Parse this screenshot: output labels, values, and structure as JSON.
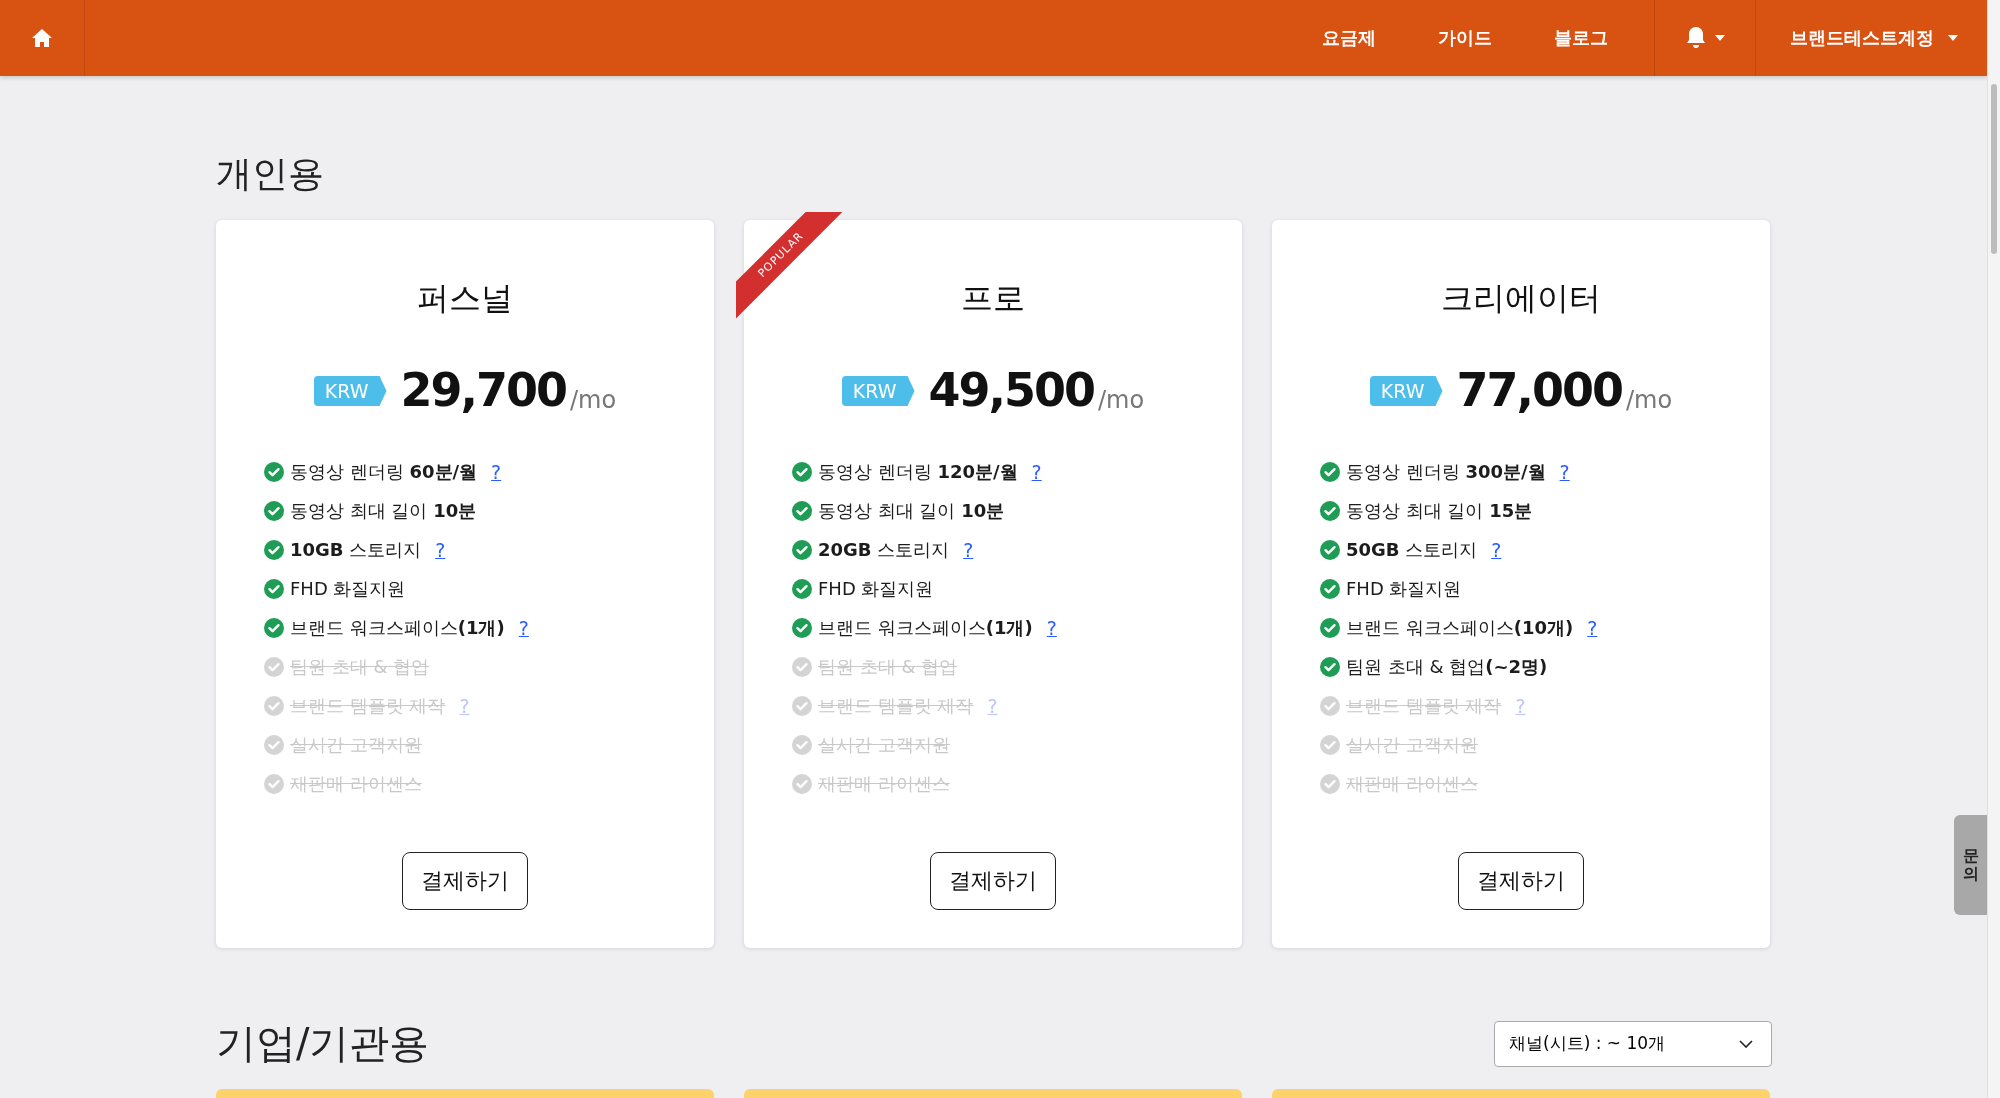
{
  "navbar": {
    "links": [
      "요금제",
      "가이드",
      "블로그"
    ],
    "account": "브랜드테스트계정"
  },
  "personal": {
    "title": "개인용",
    "plans": [
      {
        "name": "퍼스널",
        "currency": "KRW",
        "price": "29,700",
        "period": "/mo",
        "button": "결제하기",
        "features": [
          {
            "text": "동영상 렌더링 **60분/월**",
            "included": true,
            "help": "?"
          },
          {
            "text": "동영상 최대 길이 **10분**",
            "included": true
          },
          {
            "text": "**10GB** 스토리지",
            "included": true,
            "help": "?"
          },
          {
            "text": "FHD 화질지원",
            "included": true
          },
          {
            "text": "브랜드 워크스페이스**(1개)**",
            "included": true,
            "help": "?"
          },
          {
            "text": "팀원 초대 & 협업",
            "included": false
          },
          {
            "text": "브랜드 템플릿 제작",
            "included": false,
            "help": "?"
          },
          {
            "text": "실시간 고객지원",
            "included": false
          },
          {
            "text": "재판매 라이센스",
            "included": false
          }
        ]
      },
      {
        "name": "프로",
        "badge": "POPULAR",
        "currency": "KRW",
        "price": "49,500",
        "period": "/mo",
        "button": "결제하기",
        "features": [
          {
            "text": "동영상 렌더링 **120분/월**",
            "included": true,
            "help": "?"
          },
          {
            "text": "동영상 최대 길이 **10분**",
            "included": true
          },
          {
            "text": "**20GB** 스토리지",
            "included": true,
            "help": "?"
          },
          {
            "text": "FHD 화질지원",
            "included": true
          },
          {
            "text": "브랜드 워크스페이스**(1개)**",
            "included": true,
            "help": "?"
          },
          {
            "text": "팀원 초대 & 협업",
            "included": false
          },
          {
            "text": "브랜드 템플릿 제작",
            "included": false,
            "help": "?"
          },
          {
            "text": "실시간 고객지원",
            "included": false
          },
          {
            "text": "재판매 라이센스",
            "included": false
          }
        ]
      },
      {
        "name": "크리에이터",
        "currency": "KRW",
        "price": "77,000",
        "period": "/mo",
        "button": "결제하기",
        "features": [
          {
            "text": "동영상 렌더링 **300분/월**",
            "included": true,
            "help": "?"
          },
          {
            "text": "동영상 최대 길이 **15분**",
            "included": true
          },
          {
            "text": "**50GB** 스토리지",
            "included": true,
            "help": "?"
          },
          {
            "text": "FHD 화질지원",
            "included": true
          },
          {
            "text": "브랜드 워크스페이스**(10개)**",
            "included": true,
            "help": "?"
          },
          {
            "text": "팀원 초대 & 협업**(~2명)**",
            "included": true
          },
          {
            "text": "브랜드 템플릿 제작",
            "included": false,
            "help": "?"
          },
          {
            "text": "실시간 고객지원",
            "included": false
          },
          {
            "text": "재판매 라이센스",
            "included": false
          }
        ]
      }
    ]
  },
  "enterprise": {
    "title": "기업/기관용",
    "channel_select": {
      "value": "채널(시트) : ~ 10개"
    },
    "cards": [
      {
        "kind": "card"
      },
      {
        "kind": "card"
      },
      {
        "kind": "card"
      }
    ]
  },
  "side_tab": "문의"
}
